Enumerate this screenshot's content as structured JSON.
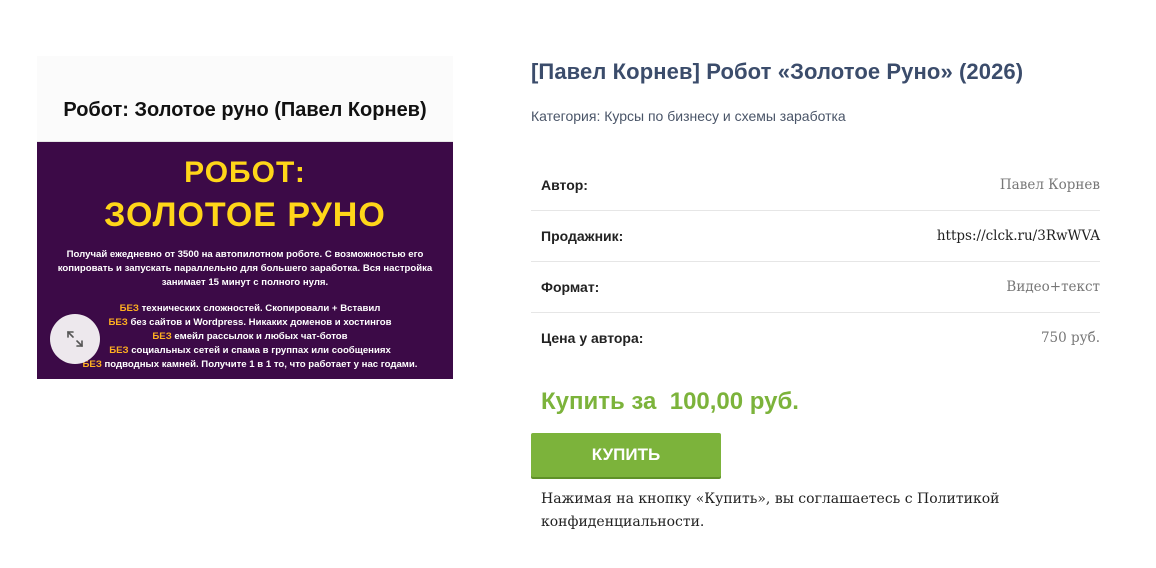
{
  "image": {
    "header": "Робот: Золотое руно (Павел Корнев)",
    "line1": "РОБОТ:",
    "line2": "ЗОЛОТОЕ РУНО",
    "description": "Получай ежедневно от 3500 на автопилотном роботе. С возможностью его копировать и запускать параллельно для большего заработка. Вся настройка занимает 15 минут с полного нуля.",
    "bez_word": "БЕЗ",
    "bullets": [
      "технических сложностей. Скопировали + Вставил",
      "без сайтов и Wordpress. Никаких доменов и хостингов",
      "емейл рассылок и любых чат-ботов",
      "социальных сетей и спама в группах или сообщениях",
      "подводных камней. Получите 1 в 1 то, что работает у нас годами."
    ]
  },
  "product": {
    "title": "[Павел Корнев] Робот «Золотое Руно» (2026)",
    "category_label": "Категория:",
    "category_link": "Курсы по бизнесу и схемы заработка",
    "attributes": [
      {
        "label": "Автор:",
        "value": "Павел Корнев"
      },
      {
        "label": "Продажник:",
        "value": "https://clck.ru/3RwWVA"
      },
      {
        "label": "Формат:",
        "value": "Видео+текст"
      },
      {
        "label": "Цена у автора:",
        "value": "750 руб."
      }
    ],
    "price_text": "Купить за  100,00 руб.",
    "buy_button": "КУПИТЬ",
    "notice": "Нажимая на кнопку «Купить», вы соглашаетесь с Политикой конфиденциальности."
  },
  "colors": {
    "accent": "#7cb33b",
    "title": "#3b4c6b",
    "image_bg": "#3c0a47",
    "image_headline": "#ffd619"
  },
  "icons": [
    "expand-icon"
  ]
}
